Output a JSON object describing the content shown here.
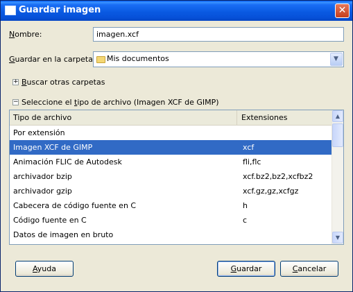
{
  "window": {
    "title": "Guardar imagen",
    "close": "✕"
  },
  "name_row": {
    "label_first": "N",
    "label_rest": "ombre:",
    "value": "imagen.xcf"
  },
  "folder_row": {
    "label_first": "G",
    "label_rest": "uardar en la carpeta:",
    "value": "Mis documentos",
    "dropdown_arrow": "▼"
  },
  "browse": {
    "expander": "+",
    "label_first": "B",
    "label_rest": "uscar otras carpetas"
  },
  "filetype": {
    "expander": "−",
    "label_pre": "Seleccione el ",
    "label_u": "t",
    "label_post": "ipo de archivo (Imagen XCF de GIMP)"
  },
  "list": {
    "columns": [
      "Tipo de archivo",
      "Extensiones"
    ],
    "rows": [
      {
        "type": "Por extensión",
        "ext": ""
      },
      {
        "type": "Imagen XCF de GIMP",
        "ext": "xcf",
        "selected": true
      },
      {
        "type": "Animación FLIC de Autodesk",
        "ext": "fli,flc"
      },
      {
        "type": "archivador bzip",
        "ext": "xcf.bz2,bz2,xcfbz2"
      },
      {
        "type": "archivador gzip",
        "ext": "xcf.gz,gz,xcfgz"
      },
      {
        "type": "Cabecera de código fuente en C",
        "ext": "h"
      },
      {
        "type": "Código fuente en C",
        "ext": "c"
      },
      {
        "type": "Datos de imagen en bruto",
        "ext": ""
      }
    ],
    "scroll_up": "▲",
    "scroll_down": "▼"
  },
  "buttons": {
    "help_first": "A",
    "help_rest": "yuda",
    "save_first": "G",
    "save_rest": "uardar",
    "cancel_first": "C",
    "cancel_rest": "ancelar"
  },
  "colors": {
    "selection": "#316ac5",
    "titlebar": "#0a5ae2",
    "dialog_bg": "#ece9d8"
  }
}
